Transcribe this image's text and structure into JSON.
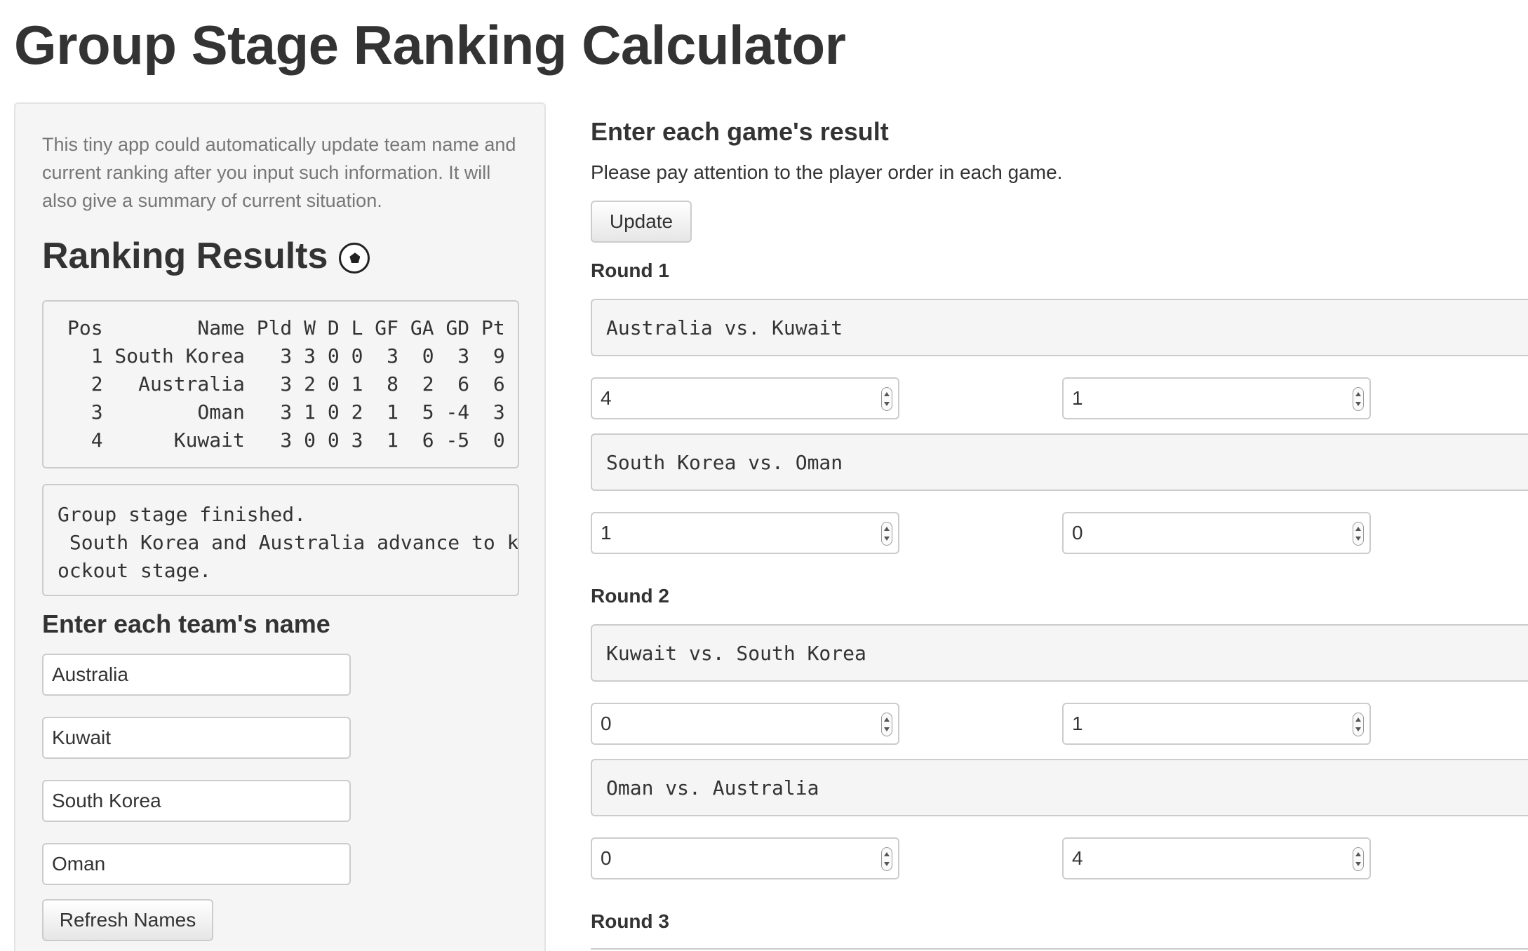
{
  "title": "Group Stage Ranking Calculator",
  "sidebar": {
    "intro": "This tiny app could automatically update team name and current ranking after you input such information. It will also give a summary of current situation.",
    "ranking_heading": "Ranking Results",
    "ranking_icon": "soccer-ball-icon",
    "ranking_table_text": "Pos        Name Pld W D L GF GA GD Pt\n  1 South Korea   3 3 0 0  3  0  3  9\n  2   Australia   3 2 0 1  8  2  6  6\n  3        Oman   3 1 0 2  1  5 -4  3\n  4      Kuwait   3 0 0 3  1  6 -5  0",
    "ranking_table": {
      "columns": [
        "Pos",
        "Name",
        "Pld",
        "W",
        "D",
        "L",
        "GF",
        "GA",
        "GD",
        "Pt"
      ],
      "rows": [
        [
          "1",
          "South Korea",
          "3",
          "3",
          "0",
          "0",
          "3",
          "0",
          "3",
          "9"
        ],
        [
          "2",
          "Australia",
          "3",
          "2",
          "0",
          "1",
          "8",
          "2",
          "6",
          "6"
        ],
        [
          "3",
          "Oman",
          "3",
          "1",
          "0",
          "2",
          "1",
          "5",
          "-4",
          "3"
        ],
        [
          "4",
          "Kuwait",
          "3",
          "0",
          "0",
          "3",
          "1",
          "6",
          "-5",
          "0"
        ]
      ]
    },
    "status_text": "Group stage finished.\n South Korea and Australia advance to kn\nockout stage.",
    "team_heading": "Enter each team's name",
    "teams": [
      "Australia",
      "Kuwait",
      "South Korea",
      "Oman"
    ],
    "refresh_label": "Refresh Names"
  },
  "main": {
    "heading": "Enter each game's result",
    "note": "Please pay attention to the player order in each game.",
    "update_label": "Update",
    "rounds": [
      {
        "label": "Round 1",
        "games": [
          {
            "match": "Australia vs. Kuwait",
            "score_home": "4",
            "score_away": "1"
          },
          {
            "match": "South Korea vs. Oman",
            "score_home": "1",
            "score_away": "0"
          }
        ]
      },
      {
        "label": "Round 2",
        "games": [
          {
            "match": "Kuwait vs. South Korea",
            "score_home": "0",
            "score_away": "1"
          },
          {
            "match": "Oman vs. Australia",
            "score_home": "0",
            "score_away": "4"
          }
        ]
      },
      {
        "label": "Round 3",
        "games": []
      }
    ]
  }
}
